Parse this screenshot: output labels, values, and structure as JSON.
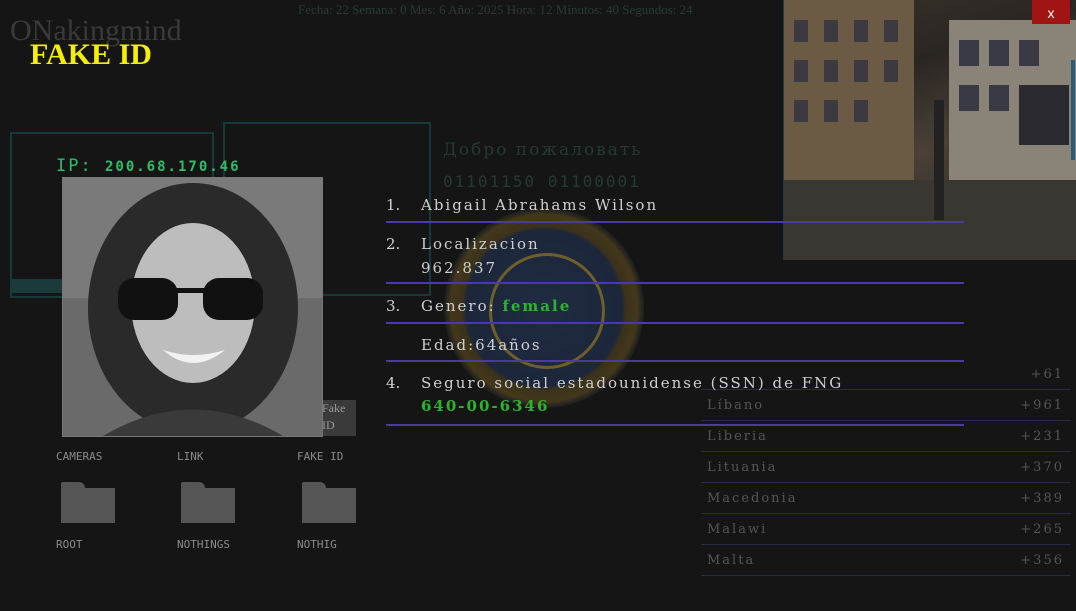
{
  "header": {
    "datetime": "Fecha: 22 Semana: 0 Mes: 6 Año: 2025 Hora: 12 Minutos: 40 Segundos: 24",
    "brand": "ONakingmind",
    "title": "FAKE ID",
    "close_label": "x"
  },
  "ip": {
    "label": "IP:",
    "value": "200.68.170.46"
  },
  "background_text": {
    "welcome": "Добро пожаловать",
    "binary": "01101150 01100001"
  },
  "desktop": {
    "icons": [
      {
        "label": "CAMERAS"
      },
      {
        "label": "LINK"
      },
      {
        "label": "FAKE ID"
      }
    ],
    "folders": [
      {
        "label": "ROOT"
      },
      {
        "label": "NOTHINGS"
      },
      {
        "label": "NOTHIG"
      }
    ],
    "small_icon_label": "Fake ID"
  },
  "profile": {
    "name_num": "1.",
    "name": "Abigail Abrahams Wilson",
    "loc_num": "2.",
    "loc_label": "Localizacion",
    "loc_value": "962.837",
    "gender_num": "3.",
    "gender_label": "Genero:",
    "gender_value": "female",
    "age_text": "Edad:64años",
    "ssn_num": "4.",
    "ssn_label": "Seguro social estadounidense (SSN) de FNG",
    "ssn_value": "640-00-6346"
  },
  "countries": [
    {
      "name": "",
      "code": "+61"
    },
    {
      "name": "Líbano",
      "code": "+961"
    },
    {
      "name": "Liberia",
      "code": "+231"
    },
    {
      "name": "Lituania",
      "code": "+370"
    },
    {
      "name": "Macedonia",
      "code": "+389"
    },
    {
      "name": "Malawi",
      "code": "+265"
    },
    {
      "name": "Malta",
      "code": "+356"
    }
  ],
  "colors": {
    "accent_yellow": "#f5f000",
    "accent_green": "#2bb52b",
    "divider_purple": "#4a3aa8",
    "close_red": "#a01414"
  }
}
